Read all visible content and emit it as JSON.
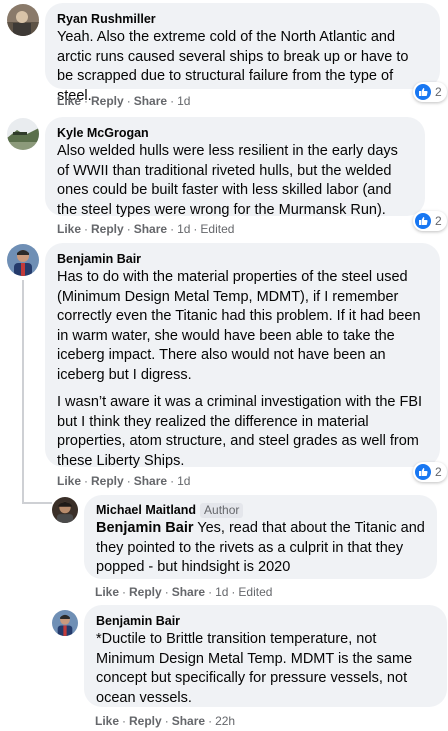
{
  "comments": [
    {
      "name": "Ryan Rushmiller",
      "paragraphs": [
        "Yeah. Also the extreme cold of the North Atlantic and arctic runs caused several ships to break up or have to be scrapped due to structural failure from the type of steel."
      ],
      "like": "Like",
      "reply": "Reply",
      "share": "Share",
      "time": "1d",
      "reactions": "2"
    },
    {
      "name": "Kyle McGrogan",
      "paragraphs": [
        "Also welded hulls were less resilient in the early days of WWII than traditional riveted hulls, but the welded ones could be built faster with less skilled labor (and the steel types were wrong for the Murmansk Run)."
      ],
      "like": "Like",
      "reply": "Reply",
      "share": "Share",
      "time": "1d",
      "edited": "Edited",
      "reactions": "2"
    },
    {
      "name": "Benjamin Bair",
      "paragraphs": [
        "Has to do with the material properties of the steel used (Minimum Design Metal Temp, MDMT), if I remember correctly even the Titanic had this problem. If it had been in warm water, she would have been able to take the iceberg impact. There also would not have been an iceberg but I digress.",
        "I wasn’t aware it was a criminal investigation with the FBI but I think they realized the difference in material properties, atom structure, and steel grades as well from these Liberty Ships."
      ],
      "like": "Like",
      "reply": "Reply",
      "share": "Share",
      "time": "1d",
      "reactions": "2"
    },
    {
      "name": "Michael Maitland",
      "badge": "Author",
      "mention": "Benjamin Bair",
      "paragraphs": [
        " Yes, read that about the Titanic and they pointed to the rivets as a culprit in that they popped - but hindsight is 2020"
      ],
      "like": "Like",
      "reply": "Reply",
      "share": "Share",
      "time": "1d",
      "edited": "Edited"
    },
    {
      "name": "Benjamin Bair",
      "paragraphs": [
        "*Ductile to Brittle transition temperature, not Minimum Design Metal Temp. MDMT is the same concept but specifically for pressure vessels, not ocean vessels."
      ],
      "like": "Like",
      "reply": "Reply",
      "share": "Share",
      "time": "22h"
    }
  ]
}
